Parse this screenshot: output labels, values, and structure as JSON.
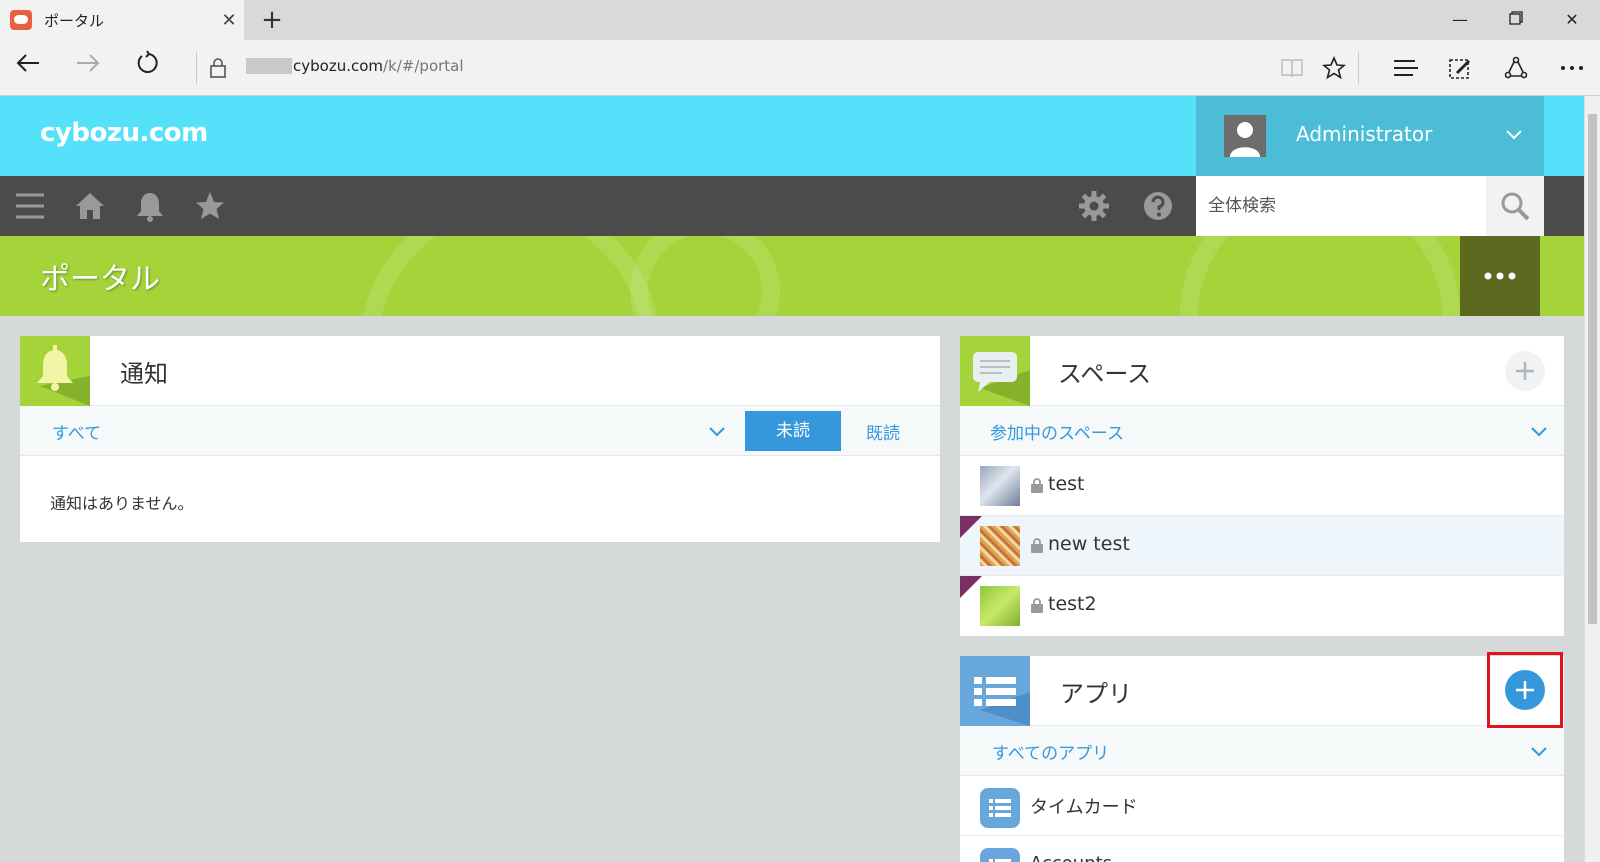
{
  "browser": {
    "tab_title": "ポータル",
    "url_domain": "cybozu.com",
    "url_path": "/k/#/portal"
  },
  "header": {
    "logo": "cybozu.com",
    "user_name": "Administrator",
    "search_placeholder": "全体検索"
  },
  "banner": {
    "title": "ポータル"
  },
  "notifications": {
    "title": "通知",
    "filter": "すべて",
    "tab_unread": "未読",
    "tab_read": "既読",
    "empty_message": "通知はありません。"
  },
  "spaces": {
    "title": "スペース",
    "filter": "参加中のスペース",
    "items": [
      {
        "name": "test"
      },
      {
        "name": "new test"
      },
      {
        "name": "test2"
      }
    ]
  },
  "apps": {
    "title": "アプリ",
    "filter": "すべてのアプリ",
    "items": [
      {
        "name": "タイムカード"
      },
      {
        "name": "Accounts"
      }
    ]
  },
  "colors": {
    "header_blue": "#56e1fa",
    "banner_green": "#a4d43a",
    "accent_blue": "#3498db",
    "highlight_red": "#e0121e"
  }
}
